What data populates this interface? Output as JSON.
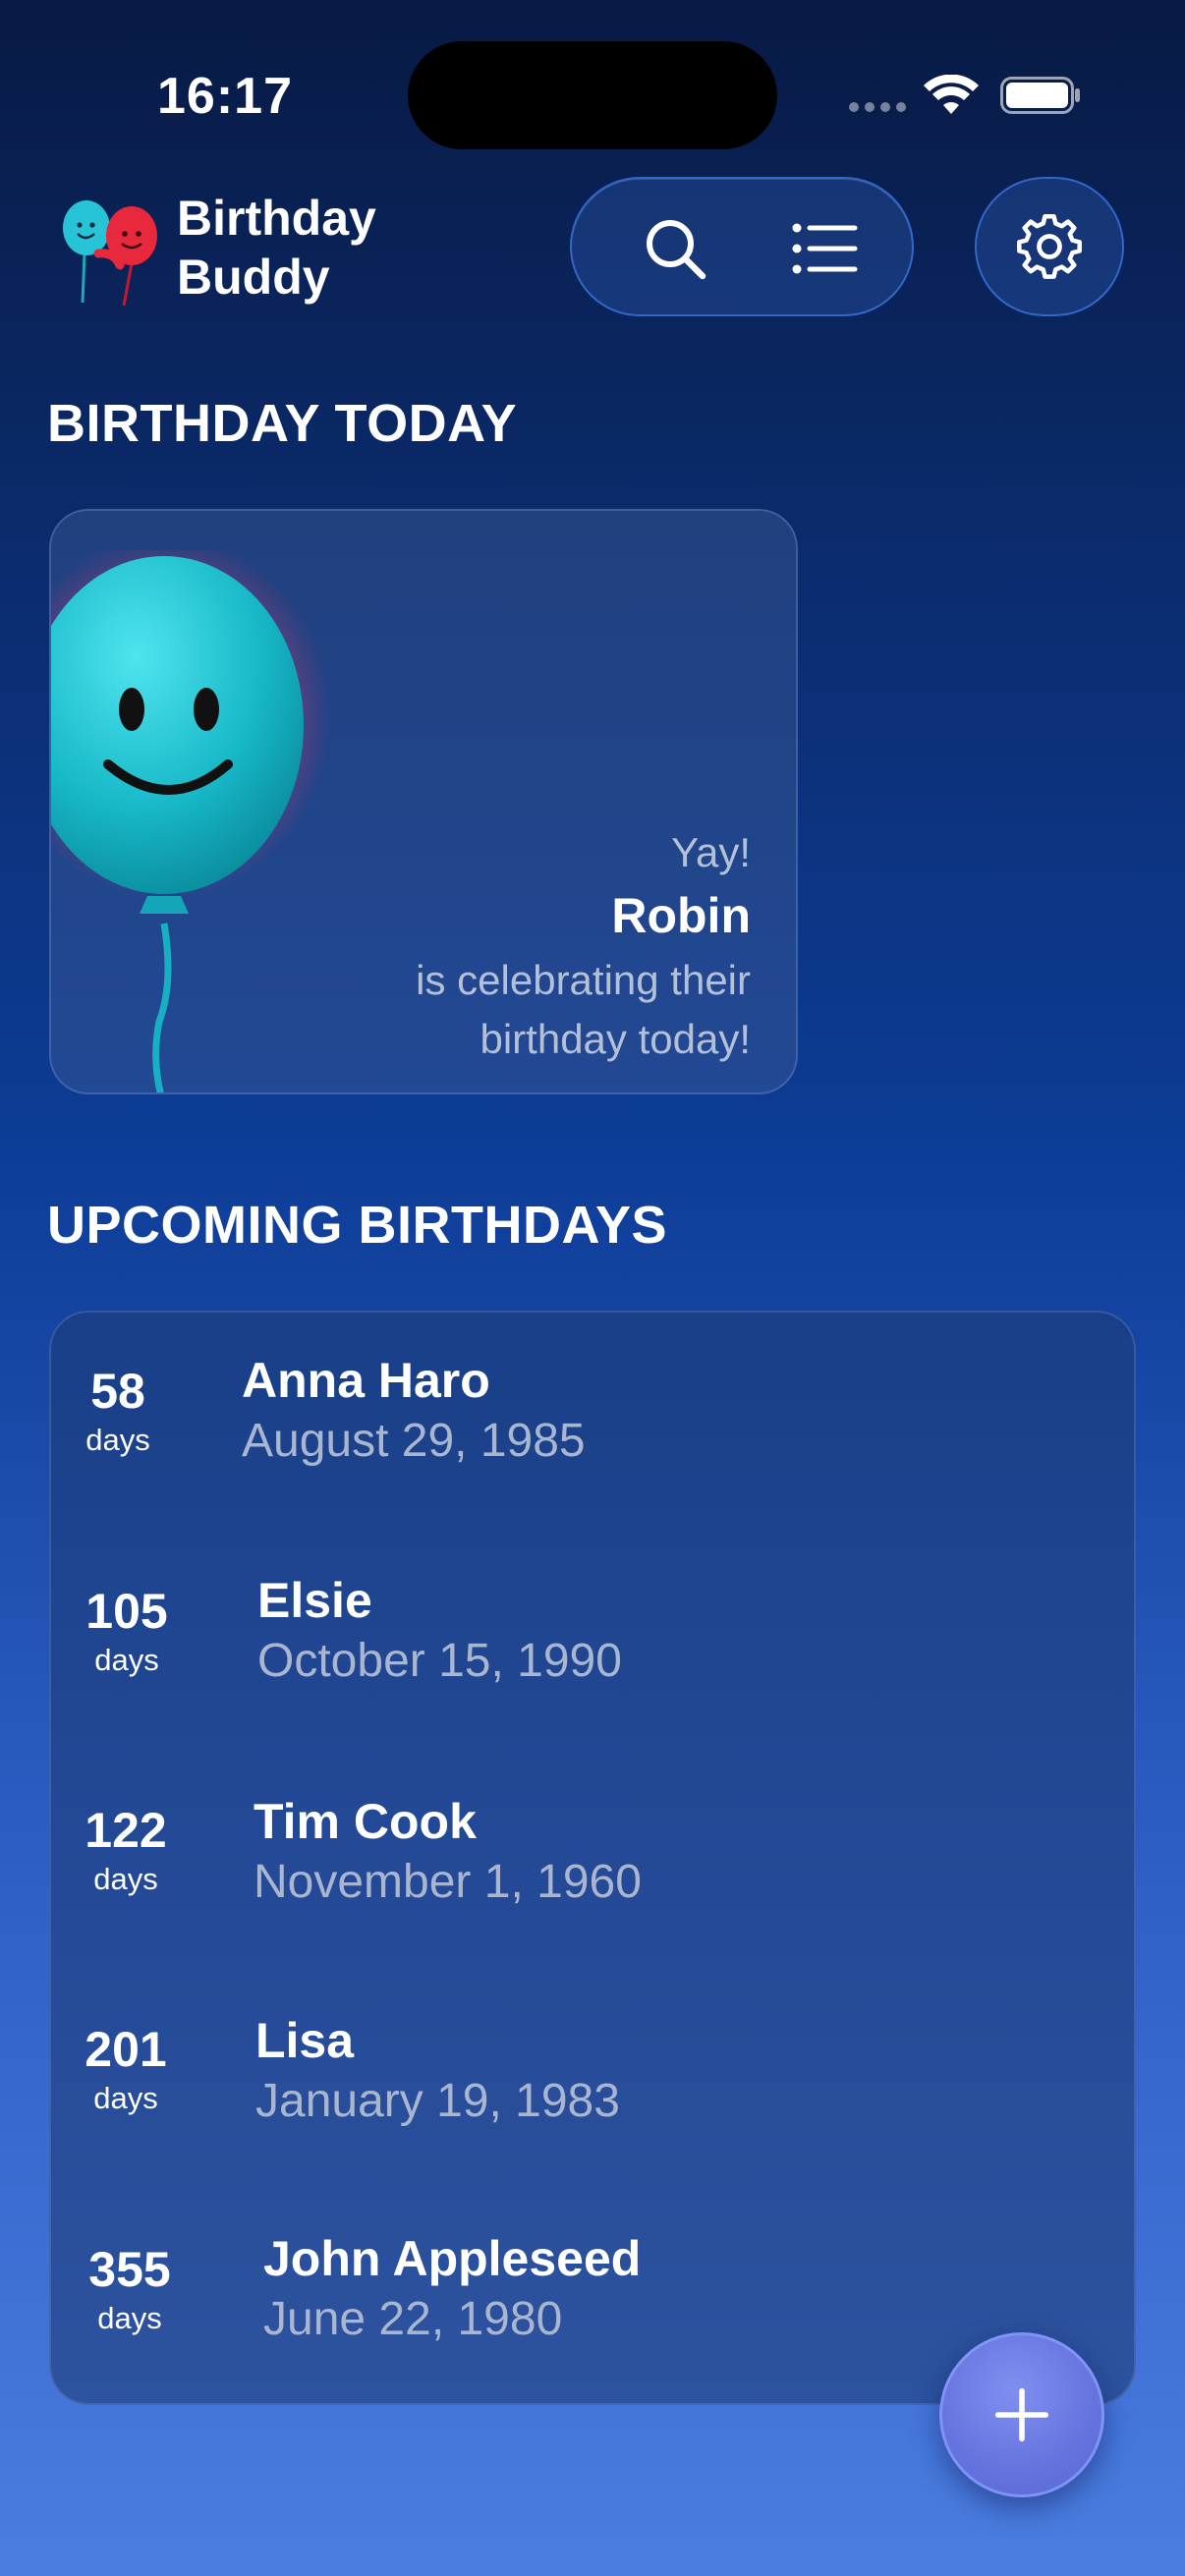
{
  "status_bar": {
    "time": "16:17"
  },
  "header": {
    "app_title": "Birthday Buddy",
    "logo_icon": "balloons-logo-icon",
    "search_icon": "search-icon",
    "list_icon": "list-icon",
    "settings_icon": "gear-icon"
  },
  "today": {
    "section_title": "BIRTHDAY TODAY",
    "yay": "Yay!",
    "name": "Robin",
    "message": "is celebrating their birthday today!",
    "art_icon": "smiling-balloon-icon"
  },
  "upcoming": {
    "section_title": "UPCOMING BIRTHDAYS",
    "items": [
      {
        "days": "58",
        "days_label": "days",
        "name": "Anna Haro",
        "date": "August 29, 1985"
      },
      {
        "days": "105",
        "days_label": "days",
        "name": "Elsie",
        "date": "October 15, 1990"
      },
      {
        "days": "122",
        "days_label": "days",
        "name": "Tim Cook",
        "date": "November 1, 1960"
      },
      {
        "days": "201",
        "days_label": "days",
        "name": "Lisa",
        "date": "January 19, 1983"
      },
      {
        "days": "355",
        "days_label": "days",
        "name": "John Appleseed",
        "date": "June 22, 1980"
      }
    ]
  },
  "fab": {
    "icon": "plus-icon"
  },
  "colors": {
    "accent": "#6474de",
    "balloon": "#1fc8d8",
    "balloon_red": "#e8283c",
    "secondary_text": "#aab6d0"
  }
}
